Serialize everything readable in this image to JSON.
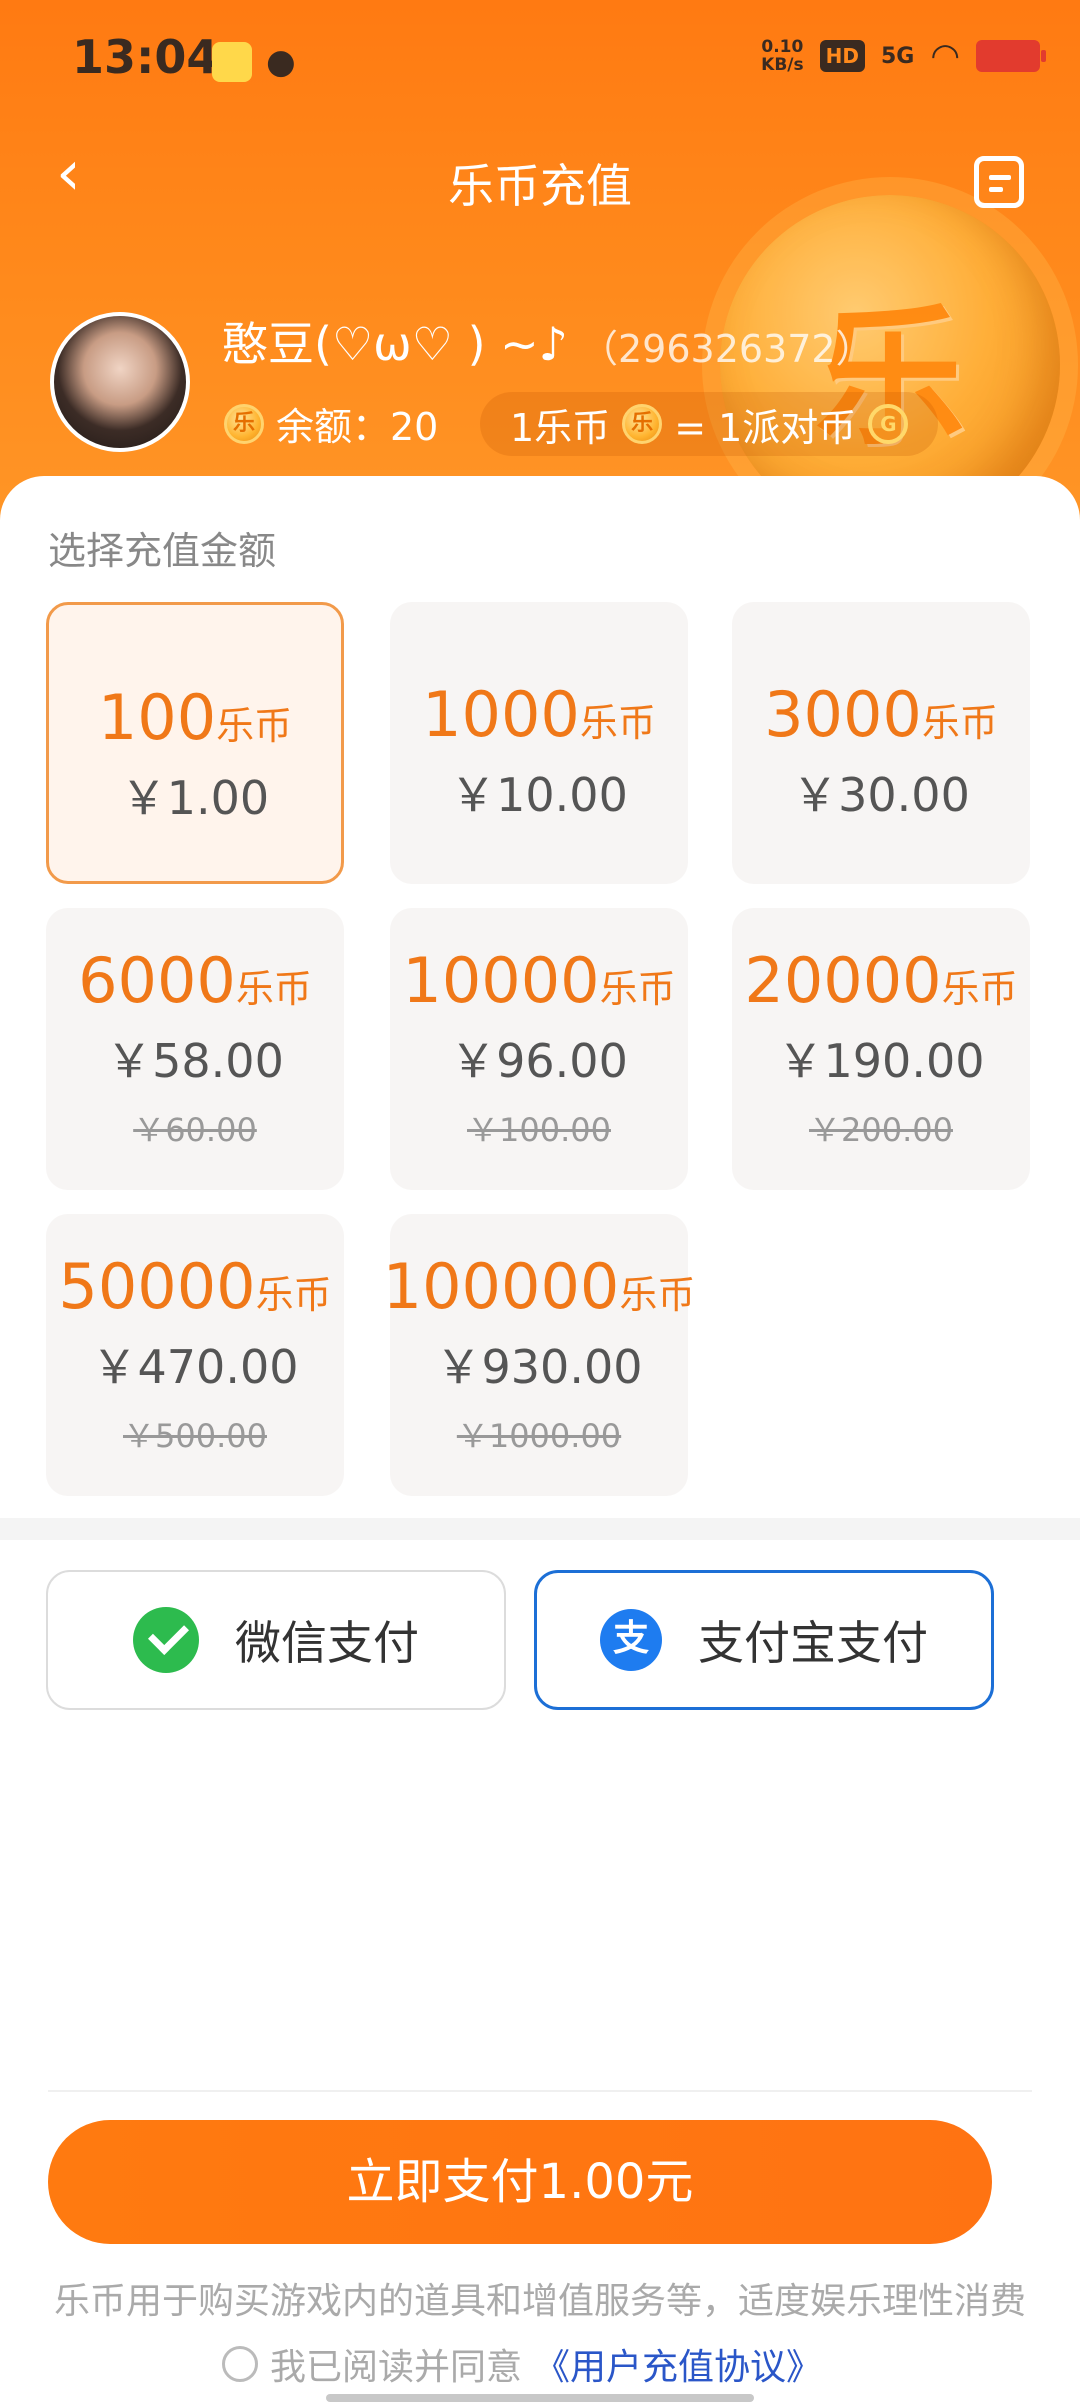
{
  "status_bar": {
    "time": "13:04",
    "net_speed_value": "0.10",
    "net_speed_unit": "KB/s",
    "hd": "HD",
    "signal": "5G"
  },
  "nav": {
    "title": "乐币充值"
  },
  "decoration": {
    "coin_char": "乐"
  },
  "user": {
    "name": "憨豆(♡ω♡ ) ~♪",
    "id": "（296326372）",
    "balance_label": "余额：20",
    "exchange_left": "1乐币",
    "exchange_right": "= 1派对币",
    "coin_char": "乐",
    "party_char": "G"
  },
  "section_label": "选择充值金额",
  "unit": "乐币",
  "packages": [
    {
      "amount": "100",
      "price": "￥1.00",
      "original": ""
    },
    {
      "amount": "1000",
      "price": "￥10.00",
      "original": ""
    },
    {
      "amount": "3000",
      "price": "￥30.00",
      "original": ""
    },
    {
      "amount": "6000",
      "price": "￥58.00",
      "original": "￥60.00"
    },
    {
      "amount": "10000",
      "price": "￥96.00",
      "original": "￥100.00"
    },
    {
      "amount": "20000",
      "price": "￥190.00",
      "original": "￥200.00"
    },
    {
      "amount": "50000",
      "price": "￥470.00",
      "original": "￥500.00"
    },
    {
      "amount": "100000",
      "price": "￥930.00",
      "original": "￥1000.00"
    }
  ],
  "payment": {
    "wechat_label": "微信支付",
    "alipay_label": "支付宝支付",
    "alipay_char": "支"
  },
  "submit_label": "立即支付1.00元",
  "disclaimer": "乐币用于购买游戏内的道具和增值服务等，适度娱乐理性消费",
  "agree_text": "我已阅读并同意",
  "agree_link": "《用户充值协议》",
  "colors": {
    "accent": "#ff7a12",
    "amount_text": "#f07818",
    "alipay_blue": "#1e7cf0",
    "wechat_green": "#2dbb4e",
    "link": "#2a56c8"
  }
}
